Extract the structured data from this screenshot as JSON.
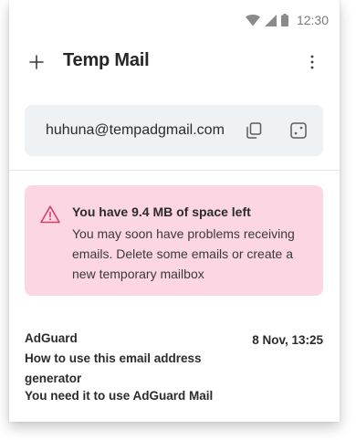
{
  "status_bar": {
    "time": "12:30"
  },
  "app_bar": {
    "title": "Temp Mail"
  },
  "email_card": {
    "address": "huhuna@tempadgmail.com"
  },
  "warning": {
    "title": "You have 9.4 MB of space left",
    "body": "You may soon have problems receiving emails. Delete some emails or create a new temporary mailbox"
  },
  "messages": [
    {
      "sender": "AdGuard",
      "date": "8 Nov, 13:25",
      "subject": "How to use this email address generator",
      "preview": "You need it to use AdGuard Mail"
    }
  ],
  "colors": {
    "warning_bg": "#fcd6e3",
    "warning_icon": "#d6416b",
    "card_bg": "#eef2f5"
  }
}
